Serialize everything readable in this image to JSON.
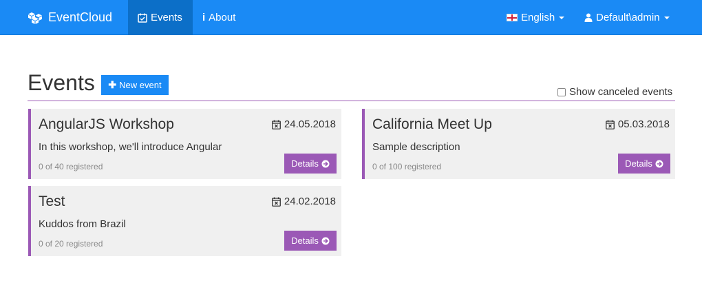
{
  "navbar": {
    "brand": "EventCloud",
    "events_label": "Events",
    "about_label": "About",
    "language_label": "English",
    "user_label": "Default\\admin"
  },
  "page": {
    "title": "Events",
    "new_event_label": "New event",
    "show_canceled_label": "Show canceled events"
  },
  "colors": {
    "primary": "#1a8af5",
    "accent": "#9b59b6",
    "card_bg": "#f0f0f0"
  },
  "events": [
    {
      "title": "AngularJS Workshop",
      "date": "24.05.2018",
      "description": "In this workshop, we'll introduce Angular",
      "registered": "0 of 40 registered",
      "details_label": "Details"
    },
    {
      "title": "California Meet Up",
      "date": "05.03.2018",
      "description": "Sample description",
      "registered": "0 of 100 registered",
      "details_label": "Details"
    },
    {
      "title": "Test",
      "date": "24.02.2018",
      "description": "Kuddos from Brazil",
      "registered": "0 of 20 registered",
      "details_label": "Details"
    }
  ]
}
